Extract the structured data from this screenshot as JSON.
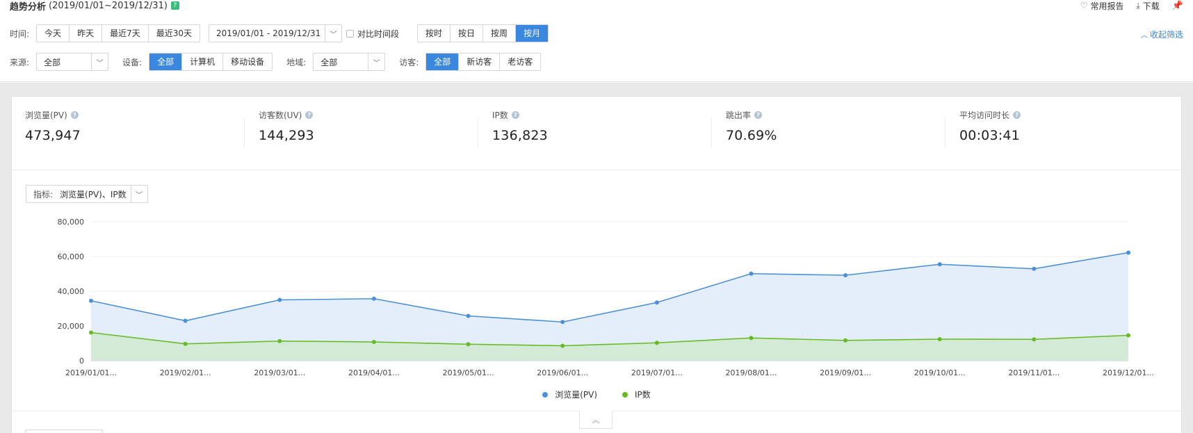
{
  "header": {
    "title": "趋势分析",
    "date_range": "(2019/01/01~2019/12/31)",
    "help_badge": "?",
    "actions": [
      {
        "label": "常用报告",
        "icon": "heart-icon"
      },
      {
        "label": "下载",
        "icon": "download-icon"
      }
    ],
    "pin_icon": "pin-icon"
  },
  "filters": {
    "time_label": "时间:",
    "time_presets": [
      "今天",
      "昨天",
      "最近7天",
      "最近30天"
    ],
    "date_value": "2019/01/01 - 2019/12/31",
    "compare_label": "对比时间段",
    "granularity": [
      {
        "label": "按时",
        "active": false
      },
      {
        "label": "按日",
        "active": false
      },
      {
        "label": "按周",
        "active": false
      },
      {
        "label": "按月",
        "active": true
      }
    ],
    "collapse_label": "收起筛选",
    "source_label": "来源:",
    "source_value": "全部",
    "device_label": "设备:",
    "devices": [
      {
        "label": "全部",
        "active": true
      },
      {
        "label": "计算机",
        "active": false
      },
      {
        "label": "移动设备",
        "active": false
      }
    ],
    "region_label": "地域:",
    "region_value": "全部",
    "visitor_label": "访客:",
    "visitors": [
      {
        "label": "全部",
        "active": true
      },
      {
        "label": "新访客",
        "active": false
      },
      {
        "label": "老访客",
        "active": false
      }
    ]
  },
  "metrics": [
    {
      "label": "浏览量(PV)",
      "value": "473,947"
    },
    {
      "label": "访客数(UV)",
      "value": "144,293"
    },
    {
      "label": "IP数",
      "value": "136,823"
    },
    {
      "label": "跳出率",
      "value": "70.69%"
    },
    {
      "label": "平均访问时长",
      "value": "00:03:41"
    }
  ],
  "indicator": {
    "label": "指标:",
    "value": "浏览量(PV)、IP数"
  },
  "colors": {
    "accent": "#3a87e0",
    "pv_line": "#4a90d9",
    "pv_fill": "#e3edfb",
    "ip_line": "#66bb22",
    "ip_fill": "#d3ead6"
  },
  "chart_data": {
    "type": "area",
    "categories": [
      "2019/01/01...",
      "2019/02/01...",
      "2019/03/01...",
      "2019/04/01...",
      "2019/05/01...",
      "2019/06/01...",
      "2019/07/01...",
      "2019/08/01...",
      "2019/09/01...",
      "2019/10/01...",
      "2019/11/01...",
      "2019/12/01..."
    ],
    "series": [
      {
        "name": "浏览量(PV)",
        "values": [
          34500,
          23000,
          35000,
          35700,
          25800,
          22300,
          33500,
          50100,
          49200,
          55500,
          52900,
          62200
        ]
      },
      {
        "name": "IP数",
        "values": [
          16200,
          9700,
          11300,
          10800,
          9500,
          8600,
          10300,
          13100,
          11700,
          12400,
          12300,
          14600
        ]
      }
    ],
    "yticks": [
      0,
      20000,
      40000,
      60000,
      80000
    ],
    "ytick_labels": [
      "0",
      "20,000",
      "40,000",
      "60,000",
      "80,000"
    ],
    "ylim": [
      0,
      80000
    ],
    "grid": true,
    "legend": "bottom-center"
  },
  "collapse_icon": "double-chevron-up-icon"
}
